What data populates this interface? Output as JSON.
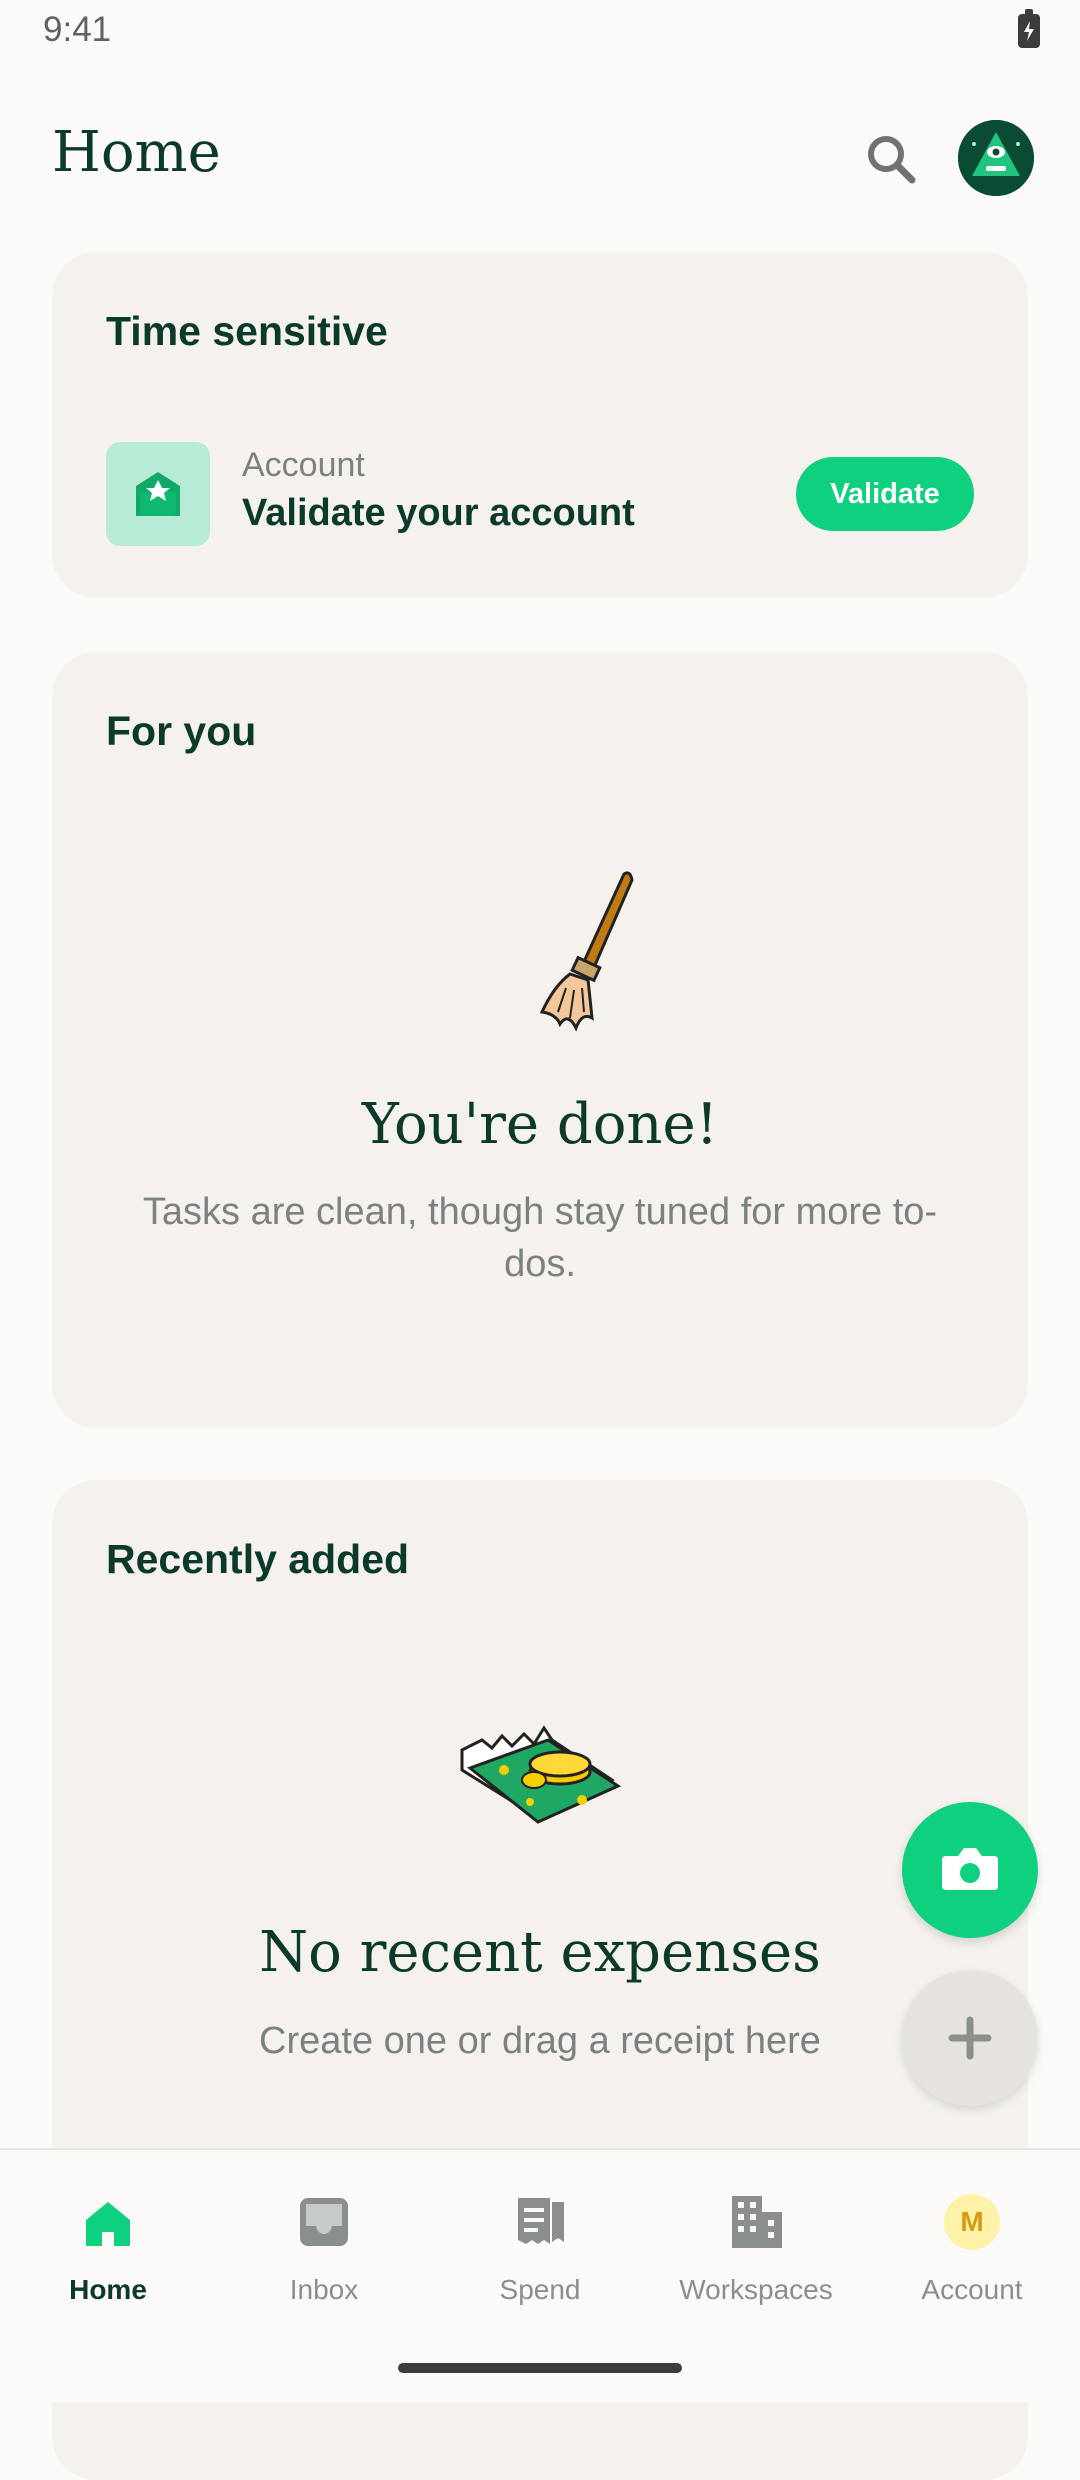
{
  "status_bar": {
    "time": "9:41"
  },
  "header": {
    "title": "Home"
  },
  "time_sensitive": {
    "title": "Time sensitive",
    "item": {
      "category": "Account",
      "message": "Validate your account",
      "action_label": "Validate"
    }
  },
  "for_you": {
    "title": "For you",
    "heading": "You're done!",
    "subtext": "Tasks are clean, though stay tuned for more to-dos."
  },
  "recently_added": {
    "title": "Recently added",
    "heading": "No recent expenses",
    "subtext": "Create one or drag a receipt here"
  },
  "avatar": {
    "initial": "M"
  },
  "nav": {
    "items": [
      {
        "label": "Home",
        "icon": "home-icon",
        "active": true
      },
      {
        "label": "Inbox",
        "icon": "inbox-icon",
        "active": false
      },
      {
        "label": "Spend",
        "icon": "receipt-icon",
        "active": false
      },
      {
        "label": "Workspaces",
        "icon": "building-icon",
        "active": false
      },
      {
        "label": "Account",
        "icon": "avatar-icon",
        "active": false
      }
    ]
  },
  "colors": {
    "brand": "#0fd07f",
    "text_dark": "#0b3a2a",
    "muted": "#7b817e",
    "card_bg": "#f5f2ee"
  }
}
